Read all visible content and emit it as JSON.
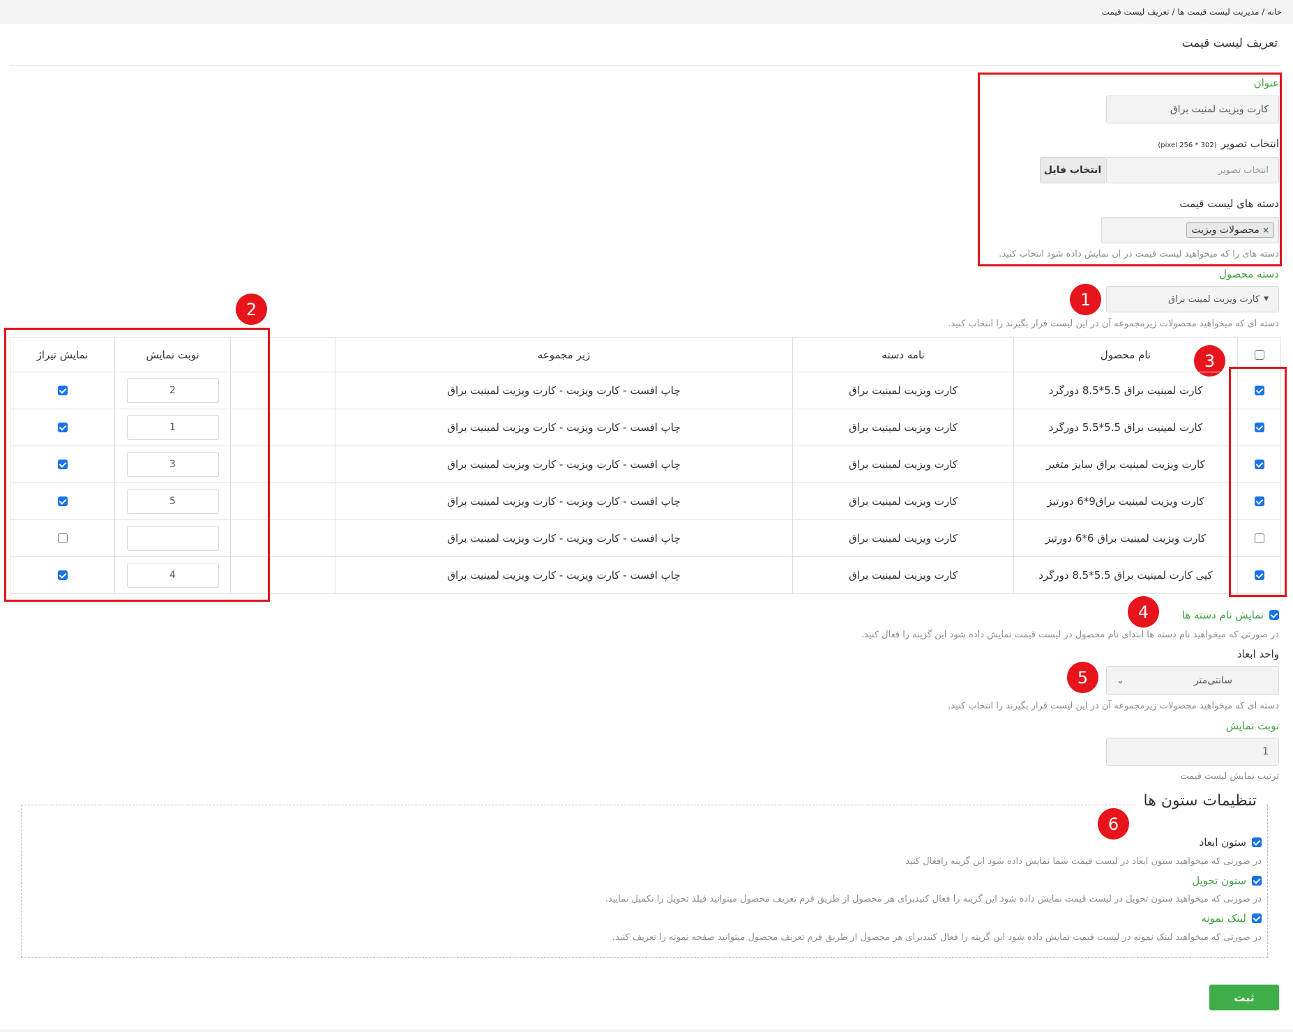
{
  "breadcrumb": {
    "home": "خانه",
    "sep1": "/",
    "item2": "مدیریت لیست قیمت ها",
    "sep2": "/",
    "item3": "تعریف لیست قیمت"
  },
  "page_title": "تعریف لیست قیمت",
  "form": {
    "title_label": "عنوان",
    "title_value": "کارت ویزیت لمنیت براق",
    "image_label": "انتخاب تصویر",
    "image_hint": "(302 * 256 pixel)",
    "image_placeholder": "انتخاب تصویر",
    "file_button": "انتخاب فایل",
    "categories_label": "دسته های لیست قیمت",
    "category_tag": "محصولات ویزیت",
    "categories_help": "دسته های را که میخواهید لیست قیمت در ان نمایش داده شود انتخاب کنید.",
    "product_category_label": "دسته محصول",
    "product_category_value": "کارت ویزیت لمینت براق",
    "product_category_help": "دسته ای که میخواهید محصولات زیرمجموعه آن در این لیست قرار بگیرند را انتخاب کنید."
  },
  "table": {
    "headers": {
      "product_name": "نام محصول",
      "category_name": "نامه دسته",
      "subcategory": "زیر مجموعه",
      "display_order": "نوبت نمایش",
      "show_circulation": "نمایش تیراژ"
    },
    "rows": [
      {
        "selected": true,
        "product": "کارت لمینیت براق 5.5*8.5 دورگرد",
        "category": "کارت ویزیت لمینیت براق",
        "sub": "چاپ افست - کارت ویزیت - کارت ویزیت لمینیت براق",
        "order": "2",
        "tiraj": true
      },
      {
        "selected": true,
        "product": "کارت لمینیت براق 5.5*5.5 دورگرد",
        "category": "کارت ویزیت لمینیت براق",
        "sub": "چاپ افست - کارت ویزیت - کارت ویزیت لمینیت براق",
        "order": "1",
        "tiraj": true
      },
      {
        "selected": true,
        "product": "کارت ویزیت لمینیت براق سایز متغیر",
        "category": "کارت ویزیت لمینیت براق",
        "sub": "چاپ افست - کارت ویزیت - کارت ویزیت لمینیت براق",
        "order": "3",
        "tiraj": true
      },
      {
        "selected": true,
        "product": "کارت ویزیت لمینیت براق9*6 دورتیز",
        "category": "کارت ویزیت لمینیت براق",
        "sub": "چاپ افست - کارت ویزیت - کارت ویزیت لمینیت براق",
        "order": "5",
        "tiraj": true
      },
      {
        "selected": false,
        "product": "کارت ویزیت لمینیت براق 6*6 دورتیز",
        "category": "کارت ویزیت لمینیت براق",
        "sub": "چاپ افست - کارت ویزیت - کارت ویزیت لمینیت براق",
        "order": "",
        "tiraj": false
      },
      {
        "selected": true,
        "product": "کپی کارت لمینیت براق 5.5*8.5 دورگرد",
        "category": "کارت ویزیت لمینیت براق",
        "sub": "چاپ افست - کارت ویزیت - کارت ویزیت لمینیت براق",
        "order": "4",
        "tiraj": true
      }
    ]
  },
  "options": {
    "show_category_names_label": "نمایش نام دسته ها",
    "show_category_names_checked": true,
    "show_category_names_help": "در صورتی که میخواهید نام دسته ها ابتدای نام محصول در لیست قیمت نمایش داده شود این گزینه را فعال کنید.",
    "dimension_unit_label": "واحد ابعاد",
    "dimension_unit_value": "سانتی‌متر",
    "dimension_unit_help": "دسته ای که میخواهید محصولات زیرمجموعه آن در این لیست قرار بگیرند را انتخاب کنید.",
    "display_order_label": "نوبت نمایش",
    "display_order_value": "1",
    "display_order_help": "ترتیب نمایش لیست قیمت"
  },
  "column_settings": {
    "legend": "تنظیمات ستون ها",
    "dimensions_label": "ستون ابعاد",
    "dimensions_help": "در صورتی که میخواهید ستون ابعاد در لیست قیمت شما نمایش داده شود این گزینه رافعال کنید",
    "delivery_label": "ستون تحویل",
    "delivery_help": "در صورتی که میخواهید ستون تحویل در لیست قیمت نمایش داده شود این گزینه را فعال کنیدبرای هر محصول از طریق فرم تعریف محصول میتوانید فیلد تحویل را تکمیل نمایید.",
    "sample_link_label": "لینک نمونه",
    "sample_link_help": "در صورتی که میخواهید لینک نمونه در لیست قیمت نمایش داده شود این گزینه را فعال کنیدبرای هر محصول از طریق فرم تعریف محصول میتوانید صفحه نمونه را تعریف کنید."
  },
  "submit_label": "ثبت",
  "annotations": {
    "m1": "1",
    "m2": "2",
    "m3": "3",
    "m4": "4",
    "m5": "5",
    "m6": "6"
  },
  "colors": {
    "accent_green": "#3fa23f",
    "submit_green": "#3fae49",
    "annotation_red": "#e3141c",
    "checkbox_blue": "#1973e8"
  }
}
